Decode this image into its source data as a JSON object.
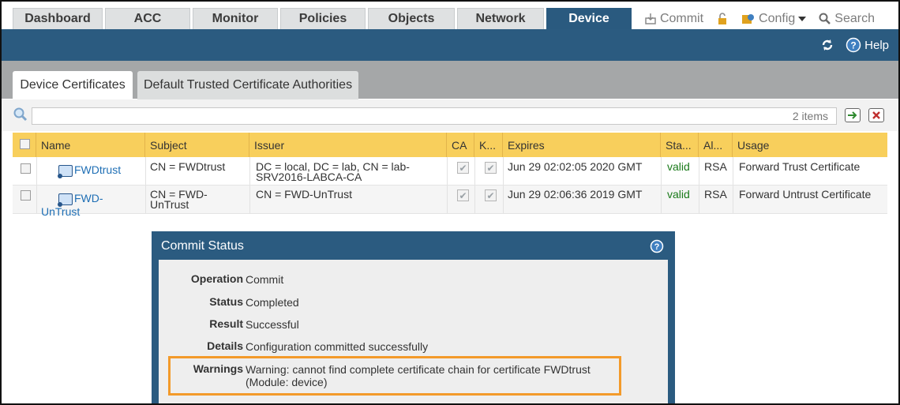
{
  "nav": {
    "tabs": [
      "Dashboard",
      "ACC",
      "Monitor",
      "Policies",
      "Objects",
      "Network",
      "Device"
    ],
    "commit": "Commit",
    "config": "Config",
    "search": "Search"
  },
  "band": {
    "help": "Help"
  },
  "subtabs": [
    "Device Certificates",
    "Default Trusted Certificate Authorities"
  ],
  "search": {
    "value": "",
    "count": "2 items"
  },
  "table": {
    "headers": [
      "Name",
      "Subject",
      "Issuer",
      "CA",
      "K...",
      "Expires",
      "Sta...",
      "Al...",
      "Usage"
    ],
    "rows": [
      {
        "name": "FWDtrust",
        "subject": "CN = FWDtrust",
        "issuer_line1": "DC = local, DC = lab, CN = lab-",
        "issuer_line2": "SRV2016-LABCA-CA",
        "expires": "Jun 29 02:02:05 2020 GMT",
        "status": "valid",
        "algorithm": "RSA",
        "usage": "Forward Trust Certificate"
      },
      {
        "name_line1": "FWD-",
        "name_line2": "UnTrust",
        "subject_line1": "CN = FWD-",
        "subject_line2": "UnTrust",
        "issuer": "CN = FWD-UnTrust",
        "expires": "Jun 29 02:06:36 2019 GMT",
        "status": "valid",
        "algorithm": "RSA",
        "usage": "Forward Untrust Certificate"
      }
    ]
  },
  "commit_status": {
    "title": "Commit Status",
    "operation_label": "Operation",
    "operation": "Commit",
    "status_label": "Status",
    "status": "Completed",
    "result_label": "Result",
    "result": "Successful",
    "details_label": "Details",
    "details": "Configuration committed successfully",
    "warnings_label": "Warnings",
    "warning_line1": "Warning: cannot find complete certificate chain for certificate FWDtrust",
    "warning_line2": "(Module: device)"
  },
  "colors": {
    "nav_blue": "#2b5b80",
    "header_yellow": "#f8cf5c",
    "warning_highlight": "#f39a2a",
    "valid_green": "#1a7a1a",
    "link_blue": "#1f6fb5"
  }
}
